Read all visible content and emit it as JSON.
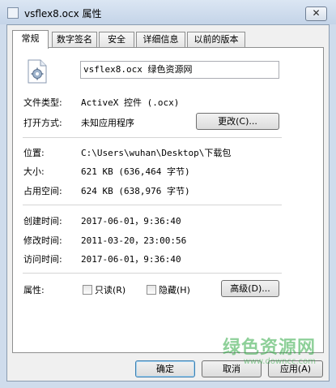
{
  "window": {
    "title": "vsflex8.ocx 属性",
    "close_label": "✕"
  },
  "tabs": [
    {
      "label": "常规",
      "active": true
    },
    {
      "label": "数字签名",
      "active": false
    },
    {
      "label": "安全",
      "active": false
    },
    {
      "label": "详细信息",
      "active": false
    },
    {
      "label": "以前的版本",
      "active": false
    }
  ],
  "file": {
    "name": "vsflex8.ocx 绿色资源网",
    "icon": "activex-file-icon"
  },
  "props": {
    "type_label": "文件类型:",
    "type_value": "ActiveX 控件 (.ocx)",
    "open_label": "打开方式:",
    "open_value": "未知应用程序",
    "change_button": "更改(C)...",
    "location_label": "位置:",
    "location_value": "C:\\Users\\wuhan\\Desktop\\下载包",
    "size_label": "大小:",
    "size_value": "621 KB (636,464 字节)",
    "disk_label": "占用空间:",
    "disk_value": "624 KB (638,976 字节)",
    "created_label": "创建时间:",
    "created_value": "2017-06-01，9:36:40",
    "modified_label": "修改时间:",
    "modified_value": "2011-03-20，23:00:56",
    "accessed_label": "访问时间:",
    "accessed_value": "2017-06-01，9:36:40",
    "attr_label": "属性:",
    "readonly_label": "只读(R)",
    "hidden_label": "隐藏(H)",
    "advanced_button": "高级(D)..."
  },
  "buttons": {
    "ok": "确定",
    "cancel": "取消",
    "apply": "应用(A)"
  },
  "watermark": {
    "main": "绿色资源网",
    "sub": "www.downcc.com"
  },
  "colors": {
    "window_frame": "#cfdcec",
    "watermark": "#32aa46"
  }
}
